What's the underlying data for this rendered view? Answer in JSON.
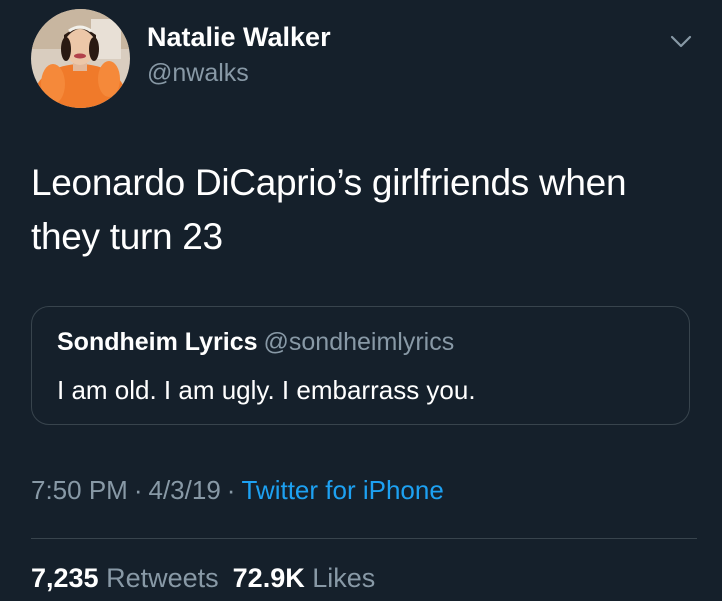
{
  "author": {
    "display_name": "Natalie Walker",
    "handle": "@nwalks",
    "avatar_icon": "profile-photo"
  },
  "menu_icon": "chevron-down-icon",
  "tweet": {
    "text": "Leonardo DiCaprio’s girlfriends when they turn 23"
  },
  "quoted_tweet": {
    "display_name": "Sondheim Lyrics",
    "handle": "@sondheimlyrics",
    "text": "I am old. I am ugly. I embarrass you."
  },
  "meta": {
    "time": "7:50 PM",
    "separator": "·",
    "date": "4/3/19",
    "source": "Twitter for iPhone"
  },
  "stats": {
    "retweets_count": "7,235",
    "retweets_label": "Retweets",
    "likes_count": "72.9K",
    "likes_label": "Likes"
  },
  "colors": {
    "background": "#15202b",
    "primary_text": "#ffffff",
    "secondary_text": "#8899a6",
    "link": "#1da1f2",
    "border": "#38444d"
  }
}
